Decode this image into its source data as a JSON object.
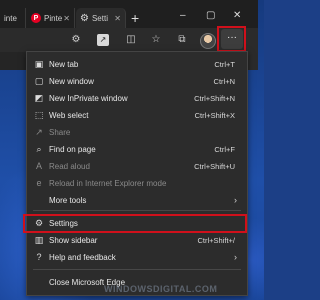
{
  "browser": {
    "tabs": [
      {
        "label": "inte",
        "active": false
      },
      {
        "label": "Pinte",
        "icon": "pinterest-icon",
        "active": false
      },
      {
        "label": "Setti",
        "icon": "gear-icon",
        "active": true
      }
    ],
    "new_tab_glyph": "+",
    "window_controls": {
      "minimize": "–",
      "maximize": "▢",
      "close": "✕"
    },
    "more_button": "···"
  },
  "menu": {
    "items": [
      {
        "label": "New tab",
        "shortcut": "Ctrl+T",
        "icon": "new-tab-icon",
        "disabled": false
      },
      {
        "label": "New window",
        "shortcut": "Ctrl+N",
        "icon": "new-window-icon",
        "disabled": false
      },
      {
        "label": "New InPrivate window",
        "shortcut": "Ctrl+Shift+N",
        "icon": "inprivate-icon",
        "disabled": false
      },
      {
        "label": "Web select",
        "shortcut": "Ctrl+Shift+X",
        "icon": "web-select-icon",
        "disabled": false
      },
      {
        "label": "Share",
        "shortcut": "",
        "icon": "share-icon",
        "disabled": true
      },
      {
        "label": "Find on page",
        "shortcut": "Ctrl+F",
        "icon": "find-icon",
        "disabled": false
      },
      {
        "label": "Read aloud",
        "shortcut": "Ctrl+Shift+U",
        "icon": "read-aloud-icon",
        "disabled": true
      },
      {
        "label": "Reload in Internet Explorer mode",
        "shortcut": "",
        "icon": "ie-mode-icon",
        "disabled": true
      },
      {
        "label": "More tools",
        "shortcut": "",
        "icon": "",
        "disabled": false,
        "submenu": true
      },
      {
        "label": "Settings",
        "shortcut": "",
        "icon": "gear-icon",
        "disabled": false
      },
      {
        "label": "Show sidebar",
        "shortcut": "Ctrl+Shift+/",
        "icon": "sidebar-icon",
        "disabled": false
      },
      {
        "label": "Help and feedback",
        "shortcut": "",
        "icon": "help-icon",
        "disabled": false,
        "submenu": true
      },
      {
        "label": "Close Microsoft Edge",
        "shortcut": "",
        "icon": "",
        "disabled": false
      }
    ]
  },
  "watermark": "WINDOWSDIGITAL.COM",
  "colors": {
    "highlight": "#d0101b",
    "menu_bg": "#2c2c2c"
  }
}
